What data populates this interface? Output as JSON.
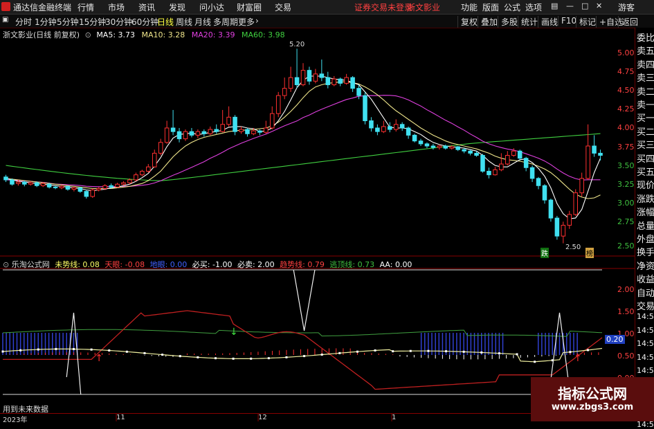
{
  "titlebar": {
    "app_name": "通达信金融终端",
    "menus": [
      "行情",
      "市场",
      "资讯",
      "发现",
      "问小达",
      "财富圈",
      "交易"
    ],
    "login_status": "证券交易未登录",
    "stock_name": "浙文影业",
    "right_menus": [
      "功能",
      "版面",
      "公式",
      "选项"
    ],
    "user": "游客"
  },
  "toolbar": {
    "periods": [
      "分时",
      "1分钟",
      "5分钟",
      "15分钟",
      "30分钟",
      "60分钟",
      "日线",
      "周线",
      "月线",
      "多周期",
      "更多"
    ],
    "active_period": "日线",
    "buttons": [
      "复权",
      "叠加",
      "多股",
      "统计",
      "画线",
      "F10",
      "标记",
      "+自选",
      "返回"
    ]
  },
  "main_chart": {
    "title": "浙文影业(日线 前复权)",
    "ma_labels": [
      {
        "text": "MA5: 3.73",
        "color": "#ffffff"
      },
      {
        "text": "MA10: 3.28",
        "color": "#f0e68c"
      },
      {
        "text": "MA20: 3.39",
        "color": "#e040e0"
      },
      {
        "text": "MA60: 3.98",
        "color": "#40d040"
      }
    ],
    "price_axis": [
      "5.00",
      "4.75",
      "4.50",
      "4.25",
      "4.00",
      "3.75",
      "3.50",
      "3.25",
      "3.00",
      "2.75",
      "2.50"
    ],
    "high_label": "5.20",
    "low_label": "2.50",
    "tag_down": "跌",
    "tag_mark": "榜"
  },
  "indicator": {
    "name": "乐淘公式网",
    "labels": [
      {
        "text": "未势线: 0.08",
        "color": "#ffff66"
      },
      {
        "text": "天眼: -0.08",
        "color": "#ff4040"
      },
      {
        "text": "地眼: 0.00",
        "color": "#4060ff"
      },
      {
        "text": "必买: -1.00",
        "color": "#ffffff"
      },
      {
        "text": "必卖: 2.00",
        "color": "#ffffff"
      },
      {
        "text": "趋势线: 0.79",
        "color": "#ff4040"
      },
      {
        "text": "逃顶线: 0.73",
        "color": "#40c040"
      },
      {
        "text": "AA: 0.00",
        "color": "#ffffff"
      }
    ],
    "axis": [
      "2.00",
      "1.50",
      "1.00",
      "0.50",
      "0.00",
      "-0.50"
    ],
    "current_value": "0.20",
    "note": "用到未来数据"
  },
  "time_axis": [
    "2023年",
    "11",
    "12",
    "1"
  ],
  "right_panel": {
    "items": [
      "委比",
      "卖五",
      "卖四",
      "卖三",
      "卖二",
      "卖一",
      "买一",
      "买二",
      "买三",
      "买四",
      "买五",
      "现价",
      "涨跌",
      "涨幅",
      "总量",
      "外盘",
      "换手",
      "净资",
      "收益",
      "自动",
      "交易",
      "14:56",
      "14:56",
      "14:56",
      "14:56",
      "14:56",
      "14:56",
      "14:56",
      "14:56",
      "14:56"
    ]
  },
  "watermark": {
    "title": "指标公式网",
    "url": "www.zbgs3.com"
  },
  "chart_data": {
    "type": "candlestick",
    "ylim": [
      2.4,
      5.3
    ],
    "candles": [
      [
        3.42,
        3.38,
        3.45,
        3.35
      ],
      [
        3.38,
        3.32,
        3.4,
        3.3
      ],
      [
        3.33,
        3.35,
        3.38,
        3.3
      ],
      [
        3.35,
        3.32,
        3.37,
        3.29
      ],
      [
        3.32,
        3.34,
        3.36,
        3.3
      ],
      [
        3.34,
        3.3,
        3.36,
        3.28
      ],
      [
        3.3,
        3.33,
        3.35,
        3.28
      ],
      [
        3.32,
        3.28,
        3.34,
        3.26
      ],
      [
        3.28,
        3.27,
        3.3,
        3.25
      ],
      [
        3.27,
        3.29,
        3.31,
        3.25
      ],
      [
        3.29,
        3.25,
        3.3,
        3.23
      ],
      [
        3.25,
        3.27,
        3.29,
        3.22
      ],
      [
        3.27,
        3.22,
        3.28,
        3.2
      ],
      [
        3.22,
        3.15,
        3.24,
        3.12
      ],
      [
        3.15,
        3.24,
        3.26,
        3.13
      ],
      [
        3.24,
        3.26,
        3.28,
        3.22
      ],
      [
        3.26,
        3.3,
        3.32,
        3.24
      ],
      [
        3.3,
        3.28,
        3.33,
        3.26
      ],
      [
        3.28,
        3.32,
        3.34,
        3.27
      ],
      [
        3.32,
        3.34,
        3.36,
        3.3
      ],
      [
        3.34,
        3.38,
        3.4,
        3.32
      ],
      [
        3.38,
        3.45,
        3.48,
        3.36
      ],
      [
        3.45,
        3.5,
        3.52,
        3.43
      ],
      [
        3.5,
        3.56,
        3.6,
        3.48
      ],
      [
        3.56,
        3.75,
        3.8,
        3.55
      ],
      [
        3.75,
        3.9,
        3.95,
        3.72
      ],
      [
        3.9,
        4.1,
        4.2,
        3.88
      ],
      [
        4.1,
        4.05,
        4.35,
        4.0
      ],
      [
        4.05,
        3.95,
        4.1,
        3.9
      ],
      [
        3.95,
        4.05,
        4.08,
        3.92
      ],
      [
        4.05,
        4.0,
        4.1,
        3.97
      ],
      [
        4.0,
        4.05,
        4.08,
        3.96
      ],
      [
        4.05,
        4.02,
        4.08,
        3.98
      ],
      [
        4.02,
        4.08,
        4.12,
        4.0
      ],
      [
        4.08,
        4.05,
        4.15,
        4.02
      ],
      [
        4.05,
        4.15,
        4.35,
        4.04
      ],
      [
        4.15,
        4.25,
        4.4,
        4.12
      ],
      [
        4.25,
        4.05,
        4.28,
        4.0
      ],
      [
        4.05,
        4.08,
        4.12,
        4.02
      ],
      [
        4.08,
        4.02,
        4.1,
        3.98
      ],
      [
        4.02,
        4.06,
        4.1,
        4.0
      ],
      [
        4.06,
        4.04,
        4.08,
        4.0
      ],
      [
        4.04,
        4.1,
        4.2,
        4.02
      ],
      [
        4.1,
        4.3,
        4.4,
        4.08
      ],
      [
        4.3,
        4.55,
        4.6,
        4.25
      ],
      [
        4.55,
        4.65,
        4.8,
        4.5
      ],
      [
        4.65,
        4.8,
        4.95,
        4.6
      ],
      [
        4.8,
        4.7,
        5.2,
        4.65
      ],
      [
        4.7,
        4.9,
        5.0,
        4.68
      ],
      [
        4.9,
        4.75,
        4.95,
        4.7
      ],
      [
        4.75,
        4.85,
        4.92,
        4.72
      ],
      [
        4.85,
        4.8,
        5.05,
        4.75
      ],
      [
        4.8,
        4.7,
        4.88,
        4.65
      ],
      [
        4.7,
        4.78,
        4.82,
        4.68
      ],
      [
        4.78,
        4.72,
        4.8,
        4.68
      ],
      [
        4.72,
        4.8,
        4.85,
        4.7
      ],
      [
        4.8,
        4.65,
        4.82,
        4.6
      ],
      [
        4.65,
        4.55,
        4.7,
        4.5
      ],
      [
        4.55,
        4.2,
        4.6,
        4.15
      ],
      [
        4.2,
        4.1,
        4.25,
        4.05
      ],
      [
        4.1,
        4.05,
        4.15,
        4.0
      ],
      [
        4.05,
        4.12,
        4.2,
        4.03
      ],
      [
        4.12,
        4.08,
        4.18,
        4.04
      ],
      [
        4.08,
        4.15,
        4.22,
        4.05
      ],
      [
        4.15,
        4.1,
        4.18,
        4.06
      ],
      [
        4.1,
        4.0,
        4.12,
        3.95
      ],
      [
        4.0,
        3.92,
        4.02,
        3.9
      ],
      [
        3.92,
        3.88,
        3.95,
        3.85
      ],
      [
        3.88,
        3.85,
        3.9,
        3.82
      ],
      [
        3.85,
        3.83,
        3.88,
        3.8
      ],
      [
        3.83,
        3.85,
        3.87,
        3.8
      ],
      [
        3.85,
        3.82,
        3.87,
        3.8
      ],
      [
        3.82,
        3.84,
        3.86,
        3.8
      ],
      [
        3.84,
        3.8,
        3.85,
        3.78
      ],
      [
        3.8,
        3.78,
        3.82,
        3.75
      ],
      [
        3.78,
        3.75,
        3.8,
        3.72
      ],
      [
        3.75,
        3.72,
        3.78,
        3.7
      ],
      [
        3.72,
        3.5,
        3.74,
        3.48
      ],
      [
        3.5,
        3.45,
        3.55,
        3.4
      ],
      [
        3.45,
        3.52,
        3.56,
        3.44
      ],
      [
        3.52,
        3.6,
        3.75,
        3.5
      ],
      [
        3.6,
        3.72,
        3.78,
        3.58
      ],
      [
        3.72,
        3.78,
        3.82,
        3.7
      ],
      [
        3.78,
        3.68,
        3.8,
        3.65
      ],
      [
        3.68,
        3.55,
        3.7,
        3.5
      ],
      [
        3.55,
        3.4,
        3.58,
        3.35
      ],
      [
        3.4,
        3.3,
        3.42,
        3.25
      ],
      [
        3.3,
        3.1,
        3.32,
        3.05
      ],
      [
        3.1,
        2.85,
        3.12,
        2.8
      ],
      [
        2.85,
        2.6,
        2.88,
        2.55
      ],
      [
        2.6,
        2.75,
        2.8,
        2.5
      ],
      [
        2.75,
        2.9,
        2.95,
        2.7
      ],
      [
        2.9,
        3.2,
        3.25,
        2.88
      ],
      [
        3.2,
        3.4,
        3.48,
        3.15
      ],
      [
        3.4,
        3.85,
        4.15,
        3.38
      ],
      [
        3.85,
        3.75,
        4.0,
        3.7
      ],
      [
        3.75,
        3.72,
        3.8,
        3.65
      ]
    ],
    "ma5": [
      3.4,
      3.38,
      3.36,
      3.35,
      3.34,
      3.33,
      3.32,
      3.31,
      3.3,
      3.29,
      3.28,
      3.27,
      3.26,
      3.24,
      3.23,
      3.24,
      3.25,
      3.27,
      3.28,
      3.3,
      3.32,
      3.36,
      3.41,
      3.47,
      3.57,
      3.69,
      3.84,
      3.96,
      4.01,
      4.02,
      4.03,
      4.01,
      4.02,
      4.04,
      4.05,
      4.07,
      4.11,
      4.12,
      4.12,
      4.1,
      4.09,
      4.05,
      4.06,
      4.1,
      4.2,
      4.33,
      4.49,
      4.66,
      4.76,
      4.82,
      4.82,
      4.82,
      4.8,
      4.78,
      4.77,
      4.76,
      4.73,
      4.7,
      4.6,
      4.5,
      4.37,
      4.24,
      4.11,
      4.1,
      4.1,
      4.09,
      4.05,
      4.01,
      3.95,
      3.9,
      3.87,
      3.85,
      3.84,
      3.83,
      3.82,
      3.8,
      3.78,
      3.72,
      3.64,
      3.58,
      3.56,
      3.56,
      3.61,
      3.66,
      3.67,
      3.62,
      3.54,
      3.43,
      3.27,
      3.05,
      2.91,
      2.84,
      2.85,
      2.97,
      3.22,
      3.48,
      3.68
    ],
    "ma10": [
      3.4,
      3.39,
      3.38,
      3.37,
      3.36,
      3.35,
      3.34,
      3.33,
      3.32,
      3.31,
      3.3,
      3.29,
      3.28,
      3.27,
      3.26,
      3.26,
      3.26,
      3.26,
      3.27,
      3.28,
      3.29,
      3.31,
      3.33,
      3.37,
      3.43,
      3.5,
      3.6,
      3.7,
      3.78,
      3.85,
      3.9,
      3.94,
      3.97,
      3.99,
      4.01,
      4.03,
      4.05,
      4.06,
      4.07,
      4.07,
      4.08,
      4.09,
      4.1,
      4.13,
      4.18,
      4.25,
      4.33,
      4.42,
      4.52,
      4.61,
      4.67,
      4.7,
      4.72,
      4.73,
      4.74,
      4.74,
      4.73,
      4.71,
      4.67,
      4.62,
      4.56,
      4.49,
      4.41,
      4.34,
      4.28,
      4.22,
      4.16,
      4.1,
      4.05,
      4.0,
      3.96,
      3.92,
      3.89,
      3.87,
      3.85,
      3.83,
      3.81,
      3.78,
      3.75,
      3.71,
      3.68,
      3.66,
      3.65,
      3.64,
      3.62,
      3.6,
      3.57,
      3.53,
      3.48,
      3.41,
      3.33,
      3.25,
      3.18,
      3.14,
      3.12,
      3.13,
      3.17
    ]
  }
}
